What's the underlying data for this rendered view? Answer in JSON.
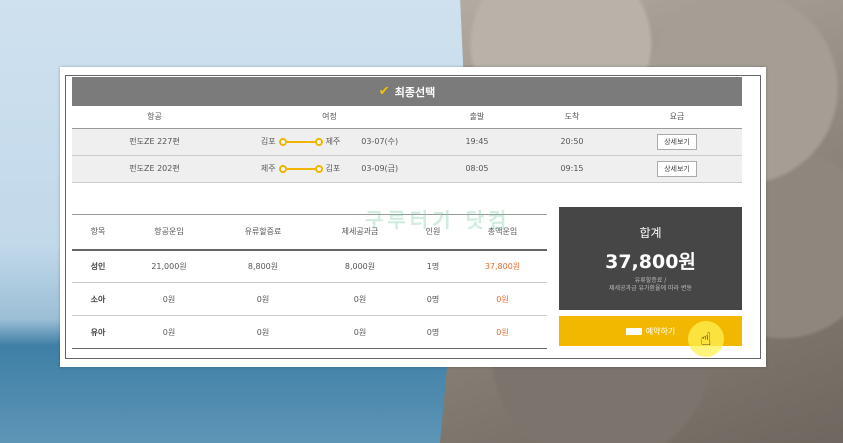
{
  "header": {
    "title": "최종선택"
  },
  "flights": {
    "columns": [
      "항공",
      "여정",
      "출발",
      "도착",
      "요금"
    ],
    "rows": [
      {
        "flight": "펀도ZE 227편",
        "from": "김포",
        "to": "제주",
        "date": "03-07(수)",
        "depart": "19:45",
        "arrive": "20:50",
        "button": "상세보기"
      },
      {
        "flight": "펀도ZE 202편",
        "from": "제주",
        "to": "김포",
        "date": "03-09(금)",
        "depart": "08:05",
        "arrive": "09:15",
        "button": "상세보기"
      }
    ]
  },
  "prices": {
    "columns": [
      "항목",
      "항공운임",
      "유류할증료",
      "제세공과금",
      "인원",
      "총액운임"
    ],
    "rows": [
      {
        "label": "성인",
        "fare": "21,000원",
        "fuel": "8,800원",
        "tax": "8,000원",
        "count": "1명",
        "total": "37,800원"
      },
      {
        "label": "소아",
        "fare": "0원",
        "fuel": "0원",
        "tax": "0원",
        "count": "0명",
        "total": "0원"
      },
      {
        "label": "유아",
        "fare": "0원",
        "fuel": "0원",
        "tax": "0원",
        "count": "0명",
        "total": "0원"
      }
    ]
  },
  "summary": {
    "label": "합계",
    "amount": "37,800원",
    "note_line1": "유류할증료 /",
    "note_line2": "제세공과금 유가환율에 따라 변동"
  },
  "reserve": {
    "label": "예약하기"
  },
  "watermark": "구루터기 닷컴",
  "colors": {
    "accent": "#f2b800",
    "highlight": "#e76b2d",
    "header_bg": "#7b7b7b",
    "total_bg": "#464646"
  }
}
